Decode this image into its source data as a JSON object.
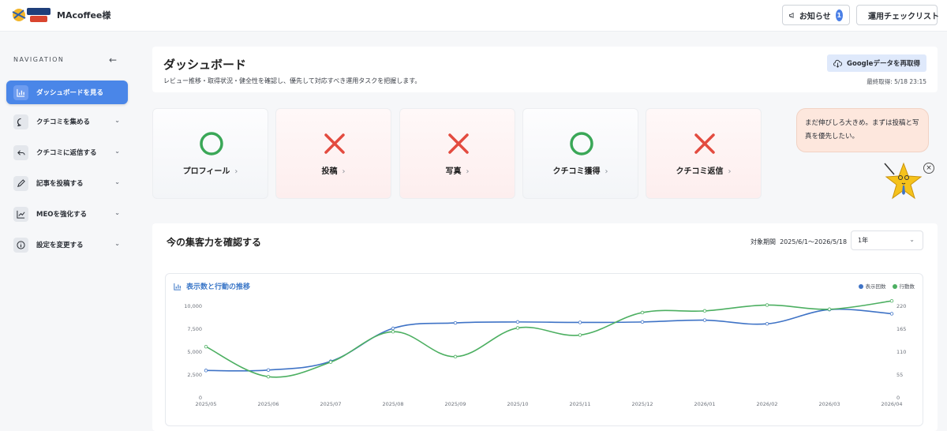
{
  "header": {
    "shop_name": "MAcoffee様",
    "news_label": "お知らせ",
    "news_count": "1",
    "checklist_label": "運用チェックリスト"
  },
  "sidebar": {
    "title": "NAVIGATION",
    "items": [
      {
        "label": "ダッシュボードを見る",
        "icon": "bar-chart-icon",
        "active": true
      },
      {
        "label": "クチコミを集める",
        "icon": "chat-bubble-icon"
      },
      {
        "label": "クチコミに返信する",
        "icon": "reply-icon"
      },
      {
        "label": "記事を投稿する",
        "icon": "pencil-icon"
      },
      {
        "label": "MEOを強化する",
        "icon": "trend-line-icon"
      },
      {
        "label": "設定を変更する",
        "icon": "info-icon"
      }
    ]
  },
  "page": {
    "title": "ダッシュボード",
    "subtitle": "レビュー推移・取得状況・健全性を確認し、優先して対応すべき運用タスクを把握します。",
    "refetch_label": "Googleデータを再取得",
    "last_fetched": "最終取得: 5/18 23:15"
  },
  "status_cards": [
    {
      "label": "プロフィール",
      "status": "ok"
    },
    {
      "label": "投稿",
      "status": "ng"
    },
    {
      "label": "写真",
      "status": "ng"
    },
    {
      "label": "クチコミ獲得",
      "status": "ok"
    },
    {
      "label": "クチコミ返信",
      "status": "ng"
    }
  ],
  "assistant": {
    "message": "まだ伸びしろ大きめ。まずは投稿と写真を優先したい。"
  },
  "traffic": {
    "title": "今の集客力を確認する",
    "period_label": "対象期間",
    "period_value": "2025/6/1〜2026/5/18",
    "range_select": "1年"
  },
  "chart_data": {
    "type": "line",
    "title": "表示数と行動の推移",
    "categories": [
      "2025/05",
      "2025/06",
      "2025/07",
      "2025/08",
      "2025/09",
      "2025/10",
      "2025/11",
      "2025/12",
      "2026/01",
      "2026/02",
      "2026/03",
      "2026/04"
    ],
    "series": [
      {
        "name": "表示回数",
        "axis": "left",
        "color": "#3f73c6",
        "values": [
          2900,
          2950,
          3900,
          7500,
          8100,
          8200,
          8150,
          8200,
          8400,
          8000,
          9550,
          9100
        ]
      },
      {
        "name": "行動数",
        "axis": "right",
        "color": "#4caf61",
        "values": [
          121,
          49,
          84,
          157,
          97,
          166,
          149,
          203,
          207,
          221,
          211,
          231
        ]
      }
    ],
    "y_left": {
      "min": 0,
      "max": 10000,
      "ticks": [
        "0",
        "2,500",
        "5,000",
        "7,500",
        "10,000"
      ]
    },
    "y_right": {
      "min": 0,
      "max": 220,
      "ticks": [
        "0",
        "55",
        "110",
        "165",
        "220"
      ]
    },
    "legend_position": "top-right",
    "grid": false
  },
  "colors": {
    "accent": "#4a86e8",
    "ok": "#3aa757",
    "ng": "#e34b3f",
    "bubble": "#fde7dd"
  }
}
